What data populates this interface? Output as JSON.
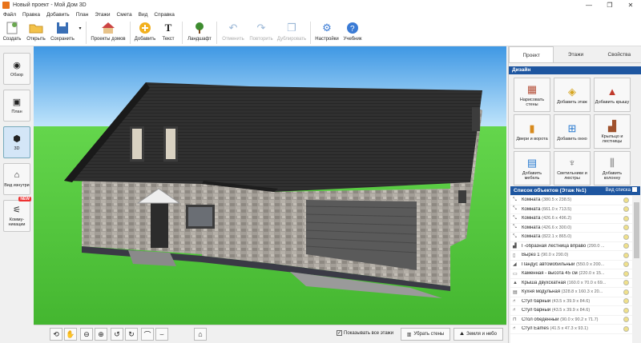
{
  "window": {
    "title": "Новый проект - Мой Дом 3D",
    "controls": [
      "—",
      "❐",
      "✕"
    ]
  },
  "menu": [
    "Файл",
    "Правка",
    "Добавить",
    "План",
    "Этажи",
    "Смета",
    "Вид",
    "Справка"
  ],
  "toolbar": {
    "create": "Создать",
    "open": "Открыть",
    "save": "Сохранить",
    "projects": "Проекты домов",
    "add": "Добавить",
    "text": "Текст",
    "landscape": "Ландшафт",
    "undo": "Отменить",
    "redo": "Повторить",
    "duplicate": "Дублировать",
    "settings": "Настройки",
    "tutorial": "Учебник"
  },
  "left": {
    "overview": "Обзор",
    "plan": "План",
    "view3d": "3D",
    "inside": "Вид изнутри",
    "community": "Комму-никации",
    "new_badge": "NEW"
  },
  "bottom": {
    "show_floors": "Показывать все этажи",
    "remove_walls": "Убрать стены",
    "ground_sky": "Земля и небо"
  },
  "right": {
    "tabs": [
      "Проект",
      "Этажи",
      "Свойства"
    ],
    "design_title": "Дизайн",
    "design": [
      "Нарисовать стены",
      "Добавить этаж",
      "Добавить крышу",
      "Двери и ворота",
      "Добавить окно",
      "Крыльцо и лестницы",
      "Добавить мебель",
      "Светильники и люстры",
      "Добавить колонну"
    ],
    "list_title": "Список объектов (Этаж №1)",
    "list_view": "Вид списка",
    "objects": [
      {
        "name": "Комната",
        "dim": "(380.5 x 238.5)"
      },
      {
        "name": "Комната",
        "dim": "(661.0 x 713.5)"
      },
      {
        "name": "Комната",
        "dim": "(426.6 x 496.2)"
      },
      {
        "name": "Комната",
        "dim": "(426.6 x 300.0)"
      },
      {
        "name": "Комната",
        "dim": "(822.1 x 865.0)"
      },
      {
        "name": "Г-образная лестница вправо",
        "dim": "(290.0 ..."
      },
      {
        "name": "Вырез 1",
        "dim": "(90.0 x 290.0)"
      },
      {
        "name": "Пандус автомобильный",
        "dim": "(550.0 x 200..."
      },
      {
        "name": "Каменная - высота 45 см",
        "dim": "(220.0 x 15..."
      },
      {
        "name": "Крыша двухскатная",
        "dim": "(160.0 x 70.0 x 69..."
      },
      {
        "name": "Кухня модульная",
        "dim": "(328.8 x 160.3 x 20..."
      },
      {
        "name": "Стул барный",
        "dim": "(43.5 x 39.9 x 84.6)"
      },
      {
        "name": "Стул барный",
        "dim": "(43.5 x 39.9 x 84.6)"
      },
      {
        "name": "Стол обеденный",
        "dim": "(90.0 x 90.2 x 71.7)"
      },
      {
        "name": "Стул Eames",
        "dim": "(41.5 x 47.3 x 93.1)"
      }
    ]
  },
  "colors": {
    "accent": "#1e56a0",
    "sky_top": "#48a0e6",
    "grass": "#4ec23a",
    "roof": "#2e2e2e"
  }
}
